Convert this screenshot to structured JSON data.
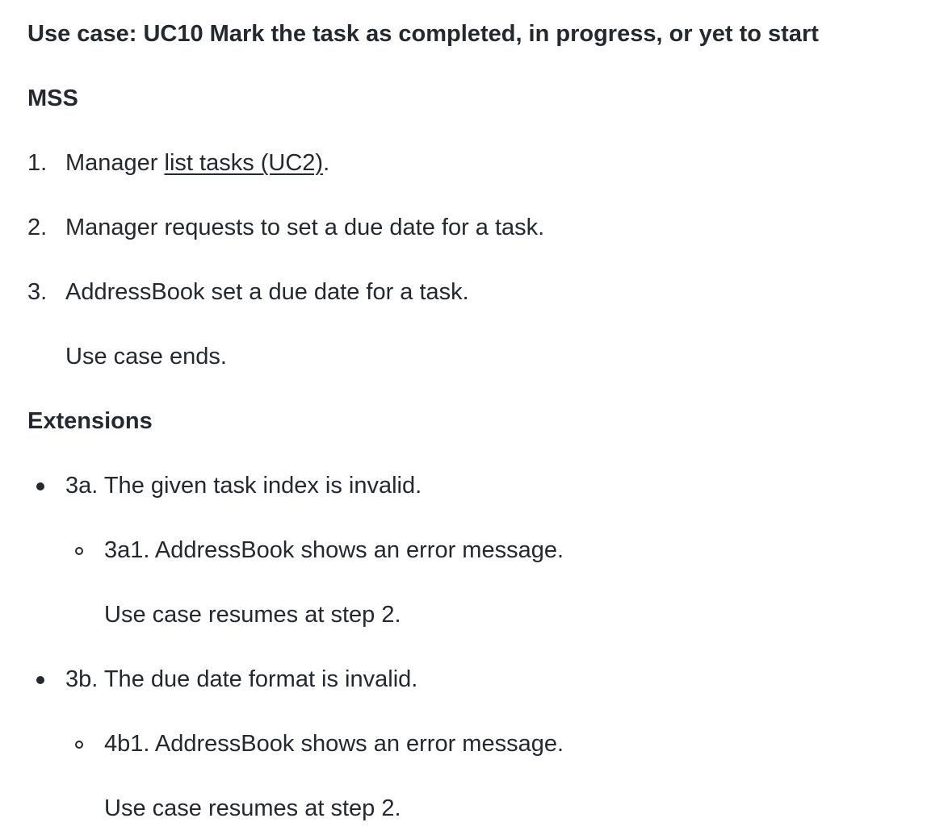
{
  "title": "Use case: UC10 Mark the task as completed, in progress, or yet to start",
  "mss_heading": "MSS",
  "steps": [
    {
      "number": "1.",
      "prefix": "Manager ",
      "link": "list tasks (UC2)",
      "suffix": "."
    },
    {
      "number": "2.",
      "text": "Manager requests to set a due date for a task."
    },
    {
      "number": "3.",
      "text": "AddressBook set a due date for a task."
    }
  ],
  "mss_end": "Use case ends.",
  "extensions_heading": "Extensions",
  "extensions": [
    {
      "text": "3a. The given task index is invalid.",
      "sub": {
        "text": "3a1. AddressBook shows an error message.",
        "note": "Use case resumes at step 2."
      }
    },
    {
      "text": "3b. The due date format is invalid.",
      "sub": {
        "text": "4b1. AddressBook shows an error message.",
        "note": "Use case resumes at step 2."
      }
    }
  ]
}
